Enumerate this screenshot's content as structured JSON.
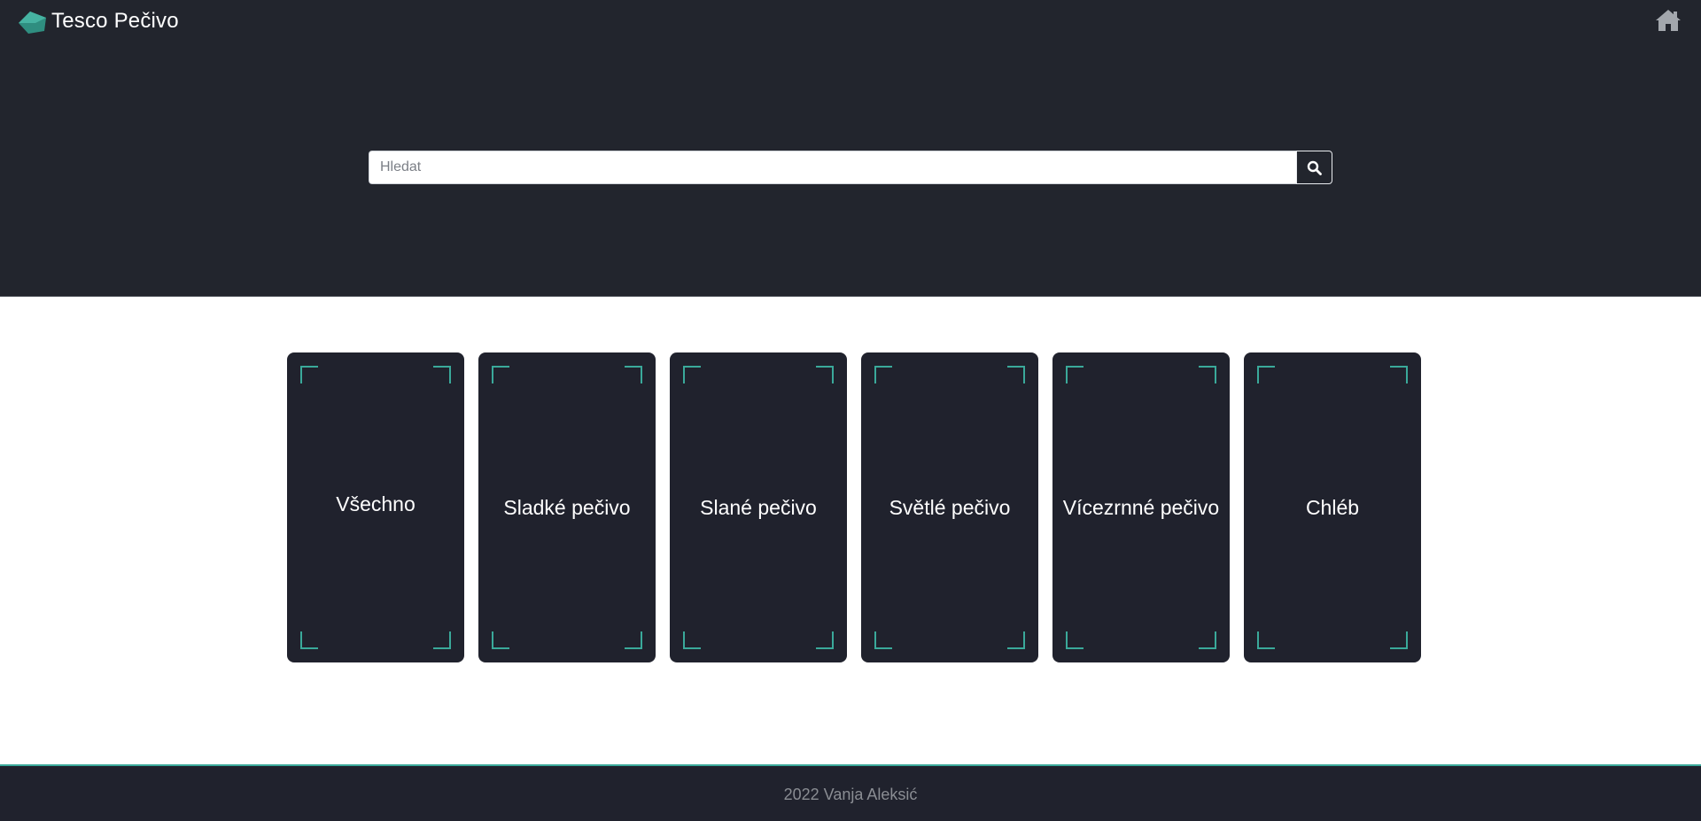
{
  "header": {
    "brand_title": "Tesco Pečivo",
    "logo_icon": "bread-loaf-icon",
    "home_icon": "home-icon"
  },
  "search": {
    "placeholder": "Hledat",
    "value": "",
    "button_icon": "search-icon"
  },
  "categories": [
    {
      "label": "Všechno"
    },
    {
      "label": "Sladké pečivo"
    },
    {
      "label": "Slané pečivo"
    },
    {
      "label": "Světlé pečivo"
    },
    {
      "label": "Vícezrnné pečivo"
    },
    {
      "label": "Chléb"
    }
  ],
  "footer": {
    "text": "2022 Vanja Aleksić"
  },
  "colors": {
    "dark_bg": "#22252d",
    "card_bg": "#20222d",
    "accent": "#3aa99a",
    "footer_text": "#8a8d93"
  }
}
